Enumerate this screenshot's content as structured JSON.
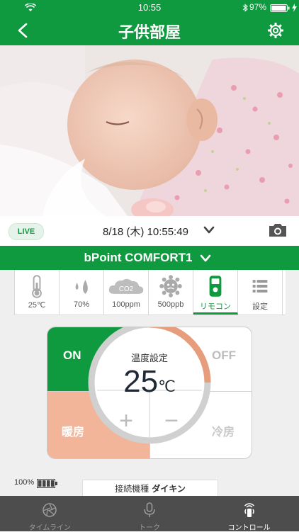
{
  "status_bar": {
    "time": "10:55",
    "battery": "97%"
  },
  "nav": {
    "title": "子供部屋",
    "back_icon": "chevron-left-icon",
    "settings_icon": "gear-icon"
  },
  "info": {
    "live_label": "LIVE",
    "datetime": "8/18 (木) 10:55:49"
  },
  "device": {
    "name": "bPoint COMFORT1"
  },
  "sensors": [
    {
      "label": "25℃",
      "icon": "thermometer-icon"
    },
    {
      "label": "70%",
      "icon": "humidity-icon"
    },
    {
      "label": "100ppm",
      "icon": "co2-cloud-icon",
      "icon_text": "CO2"
    },
    {
      "label": "500ppb",
      "icon": "voc-icon"
    },
    {
      "label": "リモコン",
      "icon": "remote-icon"
    },
    {
      "label": "設定",
      "icon": "list-icon"
    }
  ],
  "control": {
    "on_label": "ON",
    "off_label": "OFF",
    "heat_label": "暖房",
    "cool_label": "冷房",
    "set_label": "温度設定",
    "set_value": "25",
    "set_unit": "℃",
    "plus": "+",
    "minus": "−"
  },
  "footer": {
    "battery_pct": "100%",
    "connected_label": "接続機種",
    "connected_value": "ダイキン"
  },
  "tabs": [
    {
      "label": "タイムライン",
      "icon": "aperture-icon"
    },
    {
      "label": "トーク",
      "icon": "microphone-icon"
    },
    {
      "label": "コントロール",
      "icon": "remote-signal-icon",
      "active": true
    }
  ],
  "colors": {
    "brand_green": "#0f9a3f",
    "heat": "#f2b59a",
    "tabbar": "#4d4d4d"
  }
}
